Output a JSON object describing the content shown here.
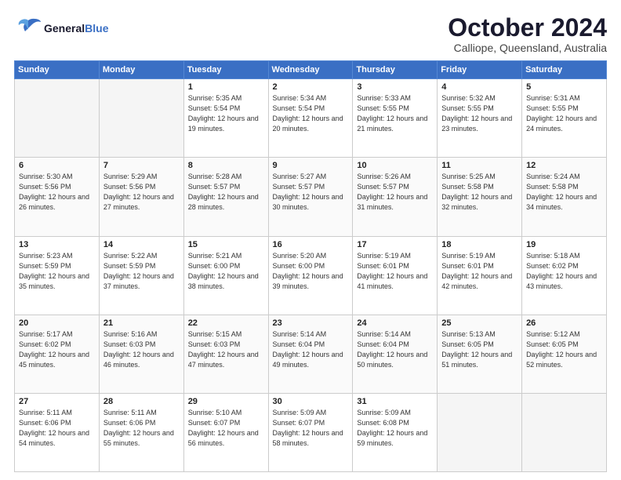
{
  "header": {
    "logo_general": "General",
    "logo_blue": "Blue",
    "month": "October 2024",
    "location": "Calliope, Queensland, Australia"
  },
  "weekdays": [
    "Sunday",
    "Monday",
    "Tuesday",
    "Wednesday",
    "Thursday",
    "Friday",
    "Saturday"
  ],
  "weeks": [
    [
      {
        "day": "",
        "empty": true
      },
      {
        "day": "",
        "empty": true
      },
      {
        "day": "1",
        "sunrise": "5:35 AM",
        "sunset": "5:54 PM",
        "daylight": "12 hours and 19 minutes."
      },
      {
        "day": "2",
        "sunrise": "5:34 AM",
        "sunset": "5:54 PM",
        "daylight": "12 hours and 20 minutes."
      },
      {
        "day": "3",
        "sunrise": "5:33 AM",
        "sunset": "5:55 PM",
        "daylight": "12 hours and 21 minutes."
      },
      {
        "day": "4",
        "sunrise": "5:32 AM",
        "sunset": "5:55 PM",
        "daylight": "12 hours and 23 minutes."
      },
      {
        "day": "5",
        "sunrise": "5:31 AM",
        "sunset": "5:55 PM",
        "daylight": "12 hours and 24 minutes."
      }
    ],
    [
      {
        "day": "6",
        "sunrise": "5:30 AM",
        "sunset": "5:56 PM",
        "daylight": "12 hours and 26 minutes."
      },
      {
        "day": "7",
        "sunrise": "5:29 AM",
        "sunset": "5:56 PM",
        "daylight": "12 hours and 27 minutes."
      },
      {
        "day": "8",
        "sunrise": "5:28 AM",
        "sunset": "5:57 PM",
        "daylight": "12 hours and 28 minutes."
      },
      {
        "day": "9",
        "sunrise": "5:27 AM",
        "sunset": "5:57 PM",
        "daylight": "12 hours and 30 minutes."
      },
      {
        "day": "10",
        "sunrise": "5:26 AM",
        "sunset": "5:57 PM",
        "daylight": "12 hours and 31 minutes."
      },
      {
        "day": "11",
        "sunrise": "5:25 AM",
        "sunset": "5:58 PM",
        "daylight": "12 hours and 32 minutes."
      },
      {
        "day": "12",
        "sunrise": "5:24 AM",
        "sunset": "5:58 PM",
        "daylight": "12 hours and 34 minutes."
      }
    ],
    [
      {
        "day": "13",
        "sunrise": "5:23 AM",
        "sunset": "5:59 PM",
        "daylight": "12 hours and 35 minutes."
      },
      {
        "day": "14",
        "sunrise": "5:22 AM",
        "sunset": "5:59 PM",
        "daylight": "12 hours and 37 minutes."
      },
      {
        "day": "15",
        "sunrise": "5:21 AM",
        "sunset": "6:00 PM",
        "daylight": "12 hours and 38 minutes."
      },
      {
        "day": "16",
        "sunrise": "5:20 AM",
        "sunset": "6:00 PM",
        "daylight": "12 hours and 39 minutes."
      },
      {
        "day": "17",
        "sunrise": "5:19 AM",
        "sunset": "6:01 PM",
        "daylight": "12 hours and 41 minutes."
      },
      {
        "day": "18",
        "sunrise": "5:19 AM",
        "sunset": "6:01 PM",
        "daylight": "12 hours and 42 minutes."
      },
      {
        "day": "19",
        "sunrise": "5:18 AM",
        "sunset": "6:02 PM",
        "daylight": "12 hours and 43 minutes."
      }
    ],
    [
      {
        "day": "20",
        "sunrise": "5:17 AM",
        "sunset": "6:02 PM",
        "daylight": "12 hours and 45 minutes."
      },
      {
        "day": "21",
        "sunrise": "5:16 AM",
        "sunset": "6:03 PM",
        "daylight": "12 hours and 46 minutes."
      },
      {
        "day": "22",
        "sunrise": "5:15 AM",
        "sunset": "6:03 PM",
        "daylight": "12 hours and 47 minutes."
      },
      {
        "day": "23",
        "sunrise": "5:14 AM",
        "sunset": "6:04 PM",
        "daylight": "12 hours and 49 minutes."
      },
      {
        "day": "24",
        "sunrise": "5:14 AM",
        "sunset": "6:04 PM",
        "daylight": "12 hours and 50 minutes."
      },
      {
        "day": "25",
        "sunrise": "5:13 AM",
        "sunset": "6:05 PM",
        "daylight": "12 hours and 51 minutes."
      },
      {
        "day": "26",
        "sunrise": "5:12 AM",
        "sunset": "6:05 PM",
        "daylight": "12 hours and 52 minutes."
      }
    ],
    [
      {
        "day": "27",
        "sunrise": "5:11 AM",
        "sunset": "6:06 PM",
        "daylight": "12 hours and 54 minutes."
      },
      {
        "day": "28",
        "sunrise": "5:11 AM",
        "sunset": "6:06 PM",
        "daylight": "12 hours and 55 minutes."
      },
      {
        "day": "29",
        "sunrise": "5:10 AM",
        "sunset": "6:07 PM",
        "daylight": "12 hours and 56 minutes."
      },
      {
        "day": "30",
        "sunrise": "5:09 AM",
        "sunset": "6:07 PM",
        "daylight": "12 hours and 58 minutes."
      },
      {
        "day": "31",
        "sunrise": "5:09 AM",
        "sunset": "6:08 PM",
        "daylight": "12 hours and 59 minutes."
      },
      {
        "day": "",
        "empty": true
      },
      {
        "day": "",
        "empty": true
      }
    ]
  ],
  "labels": {
    "sunrise": "Sunrise:",
    "sunset": "Sunset:",
    "daylight": "Daylight:"
  }
}
